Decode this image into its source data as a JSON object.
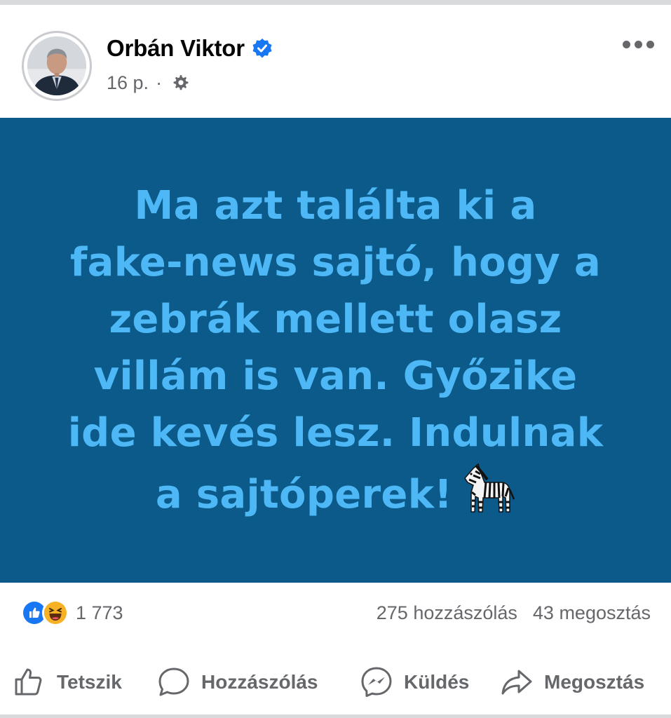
{
  "post": {
    "author": "Orbán Viktor",
    "time": "16 p.",
    "separator": "·",
    "text_lines": [
      "Ma azt találta ki a",
      "fake-news sajtó, hogy a",
      "zebrák mellett olasz",
      "villám is van. Győzike",
      "ide kevés lesz. Indulnak",
      "a sajtóperek!"
    ],
    "banner_color": "#0b5a8a",
    "text_color": "#4db8f5"
  },
  "icons": {
    "verified": "verified-badge-icon",
    "privacy": "gear-icon",
    "more": "more-options-icon",
    "emoji": "zebra-emoji-icon",
    "like_reaction": "like-reaction-icon",
    "haha_reaction": "haha-reaction-icon"
  },
  "stats": {
    "reactions_count": "1 773",
    "comments": "275 hozzászólás",
    "shares": "43 megosztás"
  },
  "actions": {
    "like": "Tetszik",
    "comment": "Hozzászólás",
    "send": "Küldés",
    "share": "Megosztás"
  },
  "colors": {
    "facebook_blue": "#1877f2",
    "secondary_text": "#65676b"
  }
}
